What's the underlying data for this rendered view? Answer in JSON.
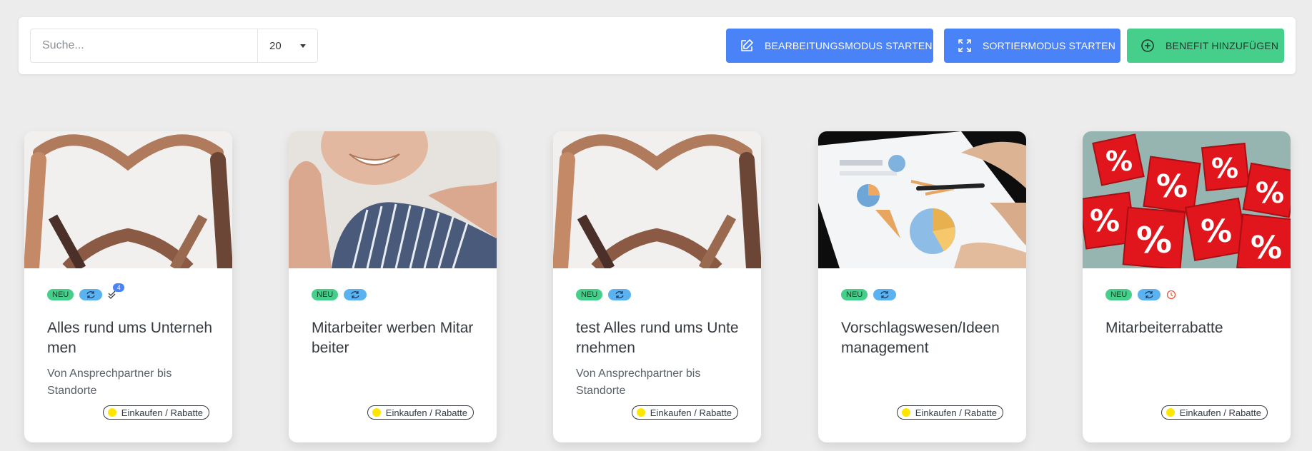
{
  "toolbar": {
    "search_placeholder": "Suche...",
    "page_size": "20",
    "edit_mode_label": "BEARBEITUNGSMODUS STARTEN",
    "sort_mode_label": "SORTIERMODUS STARTEN",
    "add_benefit_label": "BENEFIT HINZUFÜGEN"
  },
  "colors": {
    "primary": "#4a82f7",
    "success": "#45cf8a",
    "info": "#5ab3f0",
    "category_dot": "#ffe600",
    "clock": "#e85a3c"
  },
  "cards": [
    {
      "title": "Alles rund ums Unternehmen",
      "subtitle": "Von Ansprechpartner bis Standorte",
      "badge_new": "NEU",
      "approval_count": "4",
      "category": "Einkaufen / Rabatte",
      "image": "hands-heart"
    },
    {
      "title": "Mitarbeiter werben Mitarbeiter",
      "subtitle": "",
      "badge_new": "NEU",
      "category": "Einkaufen / Rabatte",
      "image": "smiling-senior"
    },
    {
      "title": "test Alles rund ums Unternehmen",
      "subtitle": "Von Ansprechpartner bis Standorte",
      "badge_new": "NEU",
      "category": "Einkaufen / Rabatte",
      "image": "hands-heart"
    },
    {
      "title": "Vorschlagswesen/Ideenmanagement",
      "subtitle": "",
      "badge_new": "NEU",
      "category": "Einkaufen / Rabatte",
      "image": "charts-pen"
    },
    {
      "title": "Mitarbeiterrabatte",
      "subtitle": "",
      "badge_new": "NEU",
      "category": "Einkaufen / Rabatte",
      "image": "percent-cubes"
    }
  ]
}
